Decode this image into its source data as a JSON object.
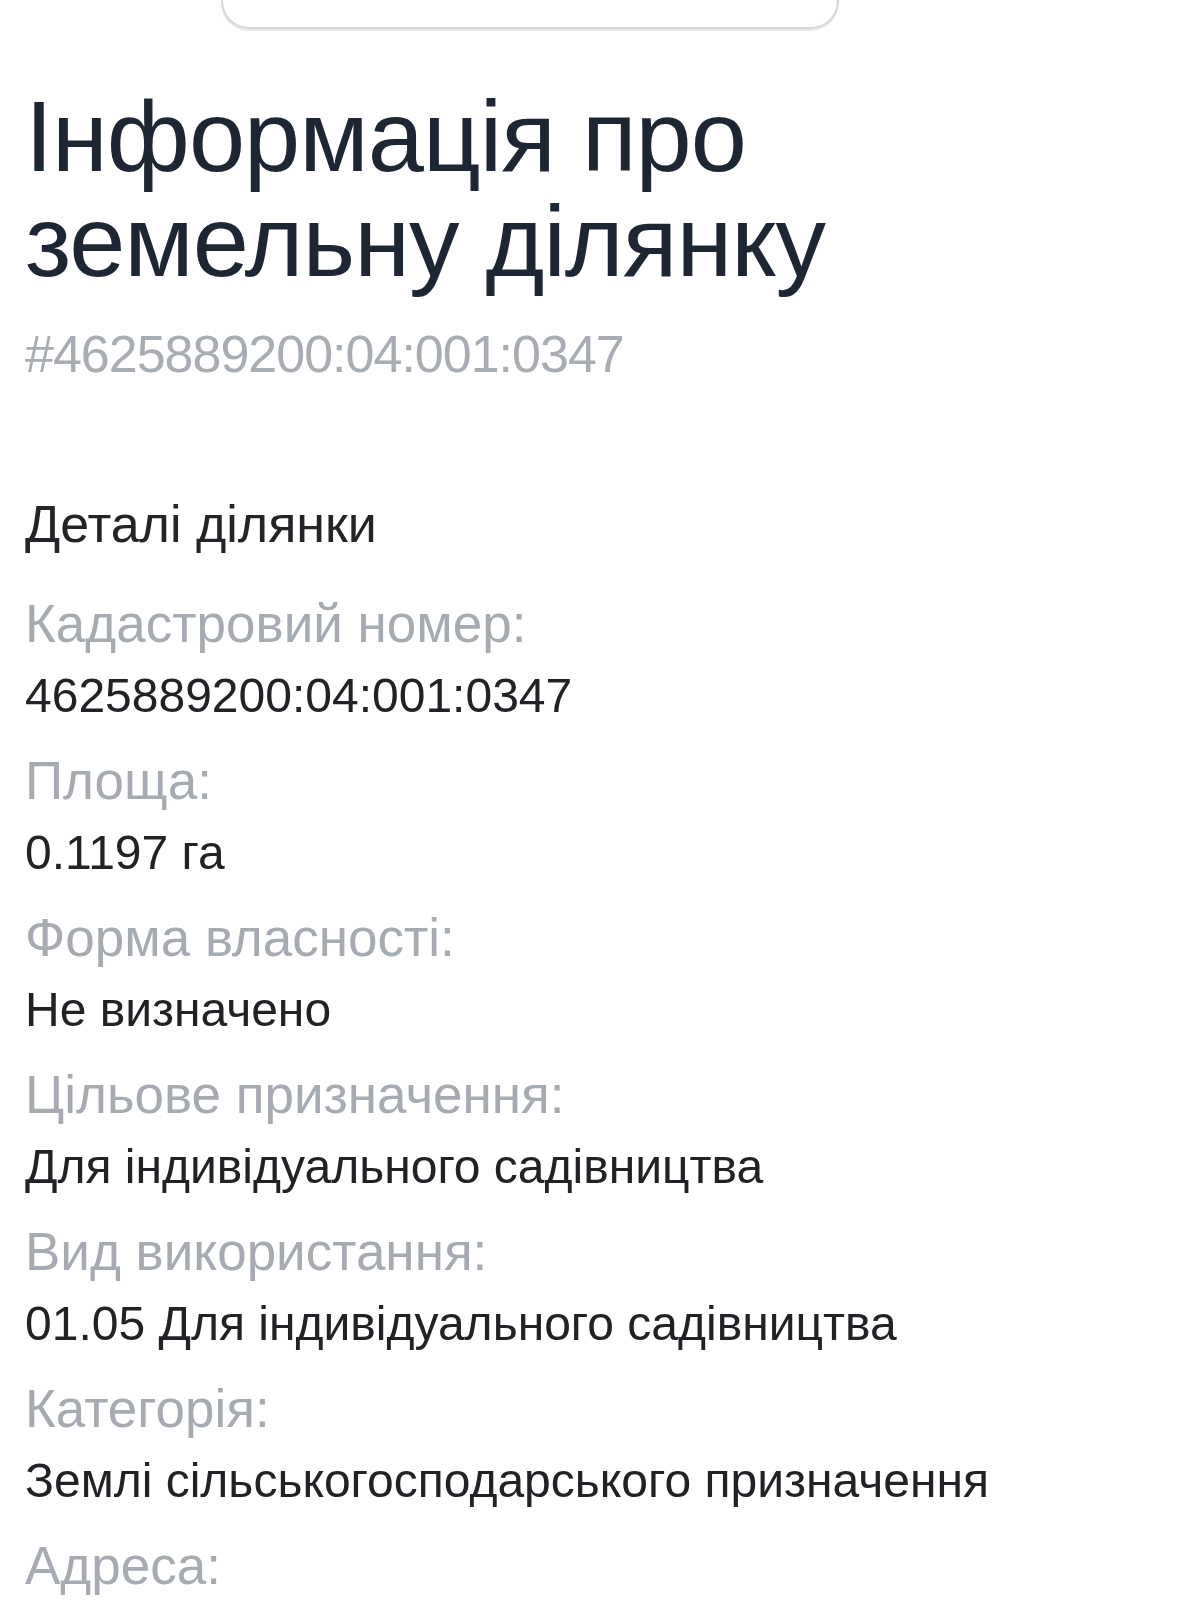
{
  "header": {
    "title": "Інформація про земельну ділянку",
    "id": "#4625889200:04:001:0347"
  },
  "details": {
    "title": "Деталі ділянки",
    "fields": [
      {
        "label": "Кадастровий номер:",
        "value": "4625889200:04:001:0347"
      },
      {
        "label": "Площа:",
        "value": "0.1197 га"
      },
      {
        "label": "Форма власності:",
        "value": "Не визначено"
      },
      {
        "label": "Цільове призначення:",
        "value": "Для індивідуального садівництва"
      },
      {
        "label": "Вид використання:",
        "value": "01.05 Для індивідуального садівництва"
      },
      {
        "label": "Категорія:",
        "value": "Землі сільськогосподарського призначення"
      },
      {
        "label": "Адреса:"
      }
    ]
  }
}
